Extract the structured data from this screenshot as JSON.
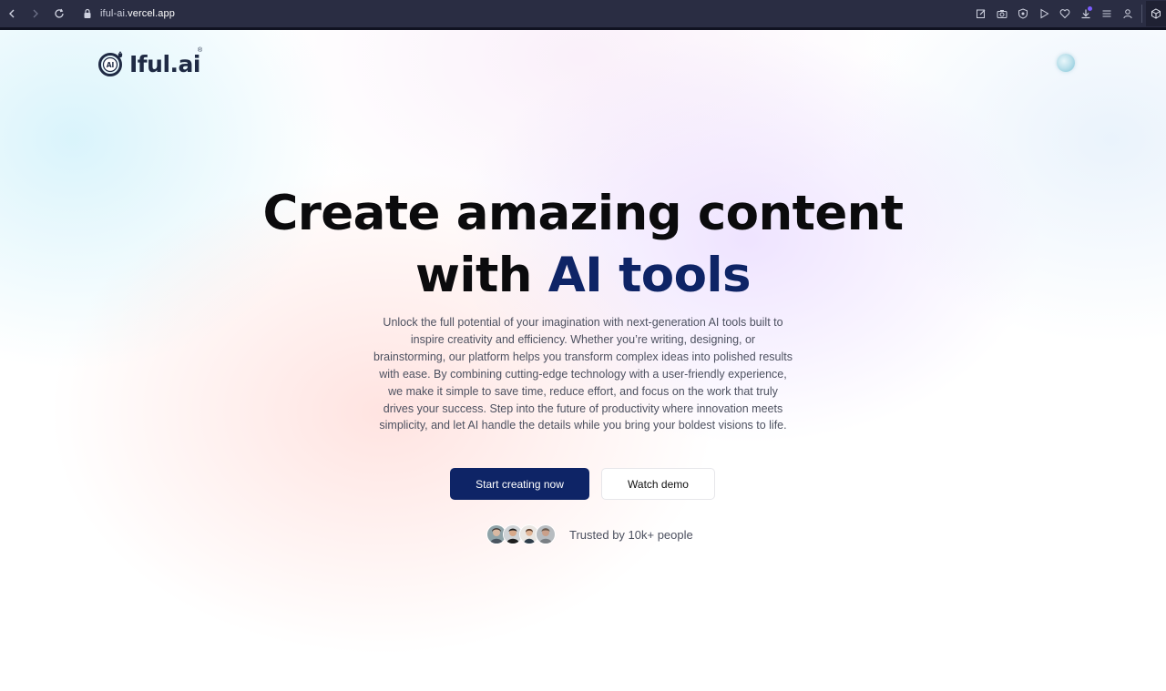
{
  "browser": {
    "url_prefix": "iful-ai.",
    "url_host": "vercel.app",
    "icons": [
      "back-icon",
      "forward-icon",
      "reload-icon",
      "lock-icon",
      "edit-icon",
      "camera-icon",
      "shield-icon",
      "play-icon",
      "heart-icon",
      "download-icon",
      "menu-icon",
      "profile-icon",
      "extension-icon"
    ]
  },
  "header": {
    "logo_text": "Iful.ai",
    "logo_badge": "AI",
    "logo_sup": "®"
  },
  "hero": {
    "title_line1": "Create amazing content",
    "title_line2_plain": "with ",
    "title_line2_accent": "AI tools",
    "description": "Unlock the full potential of your imagination with next-generation AI tools built to inspire creativity and efficiency. Whether you’re writing, designing, or brainstorming, our platform helps you transform complex ideas into polished results with ease. By combining cutting-edge technology with a user-friendly experience, we make it simple to save time, reduce effort, and focus on the work that truly drives your success. Step into the future of productivity where innovation meets simplicity, and let AI handle the details while you bring your boldest visions to life.",
    "primary_cta": "Start creating now",
    "secondary_cta": "Watch demo",
    "trust_text": "Trusted by 10k+ people"
  },
  "colors": {
    "accent": "#0e2466",
    "chrome": "#2a2d43",
    "text": "#0b0b0d",
    "muted": "#4d5160"
  }
}
